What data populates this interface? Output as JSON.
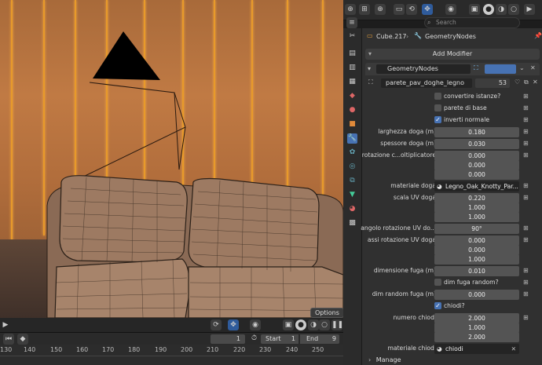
{
  "header": {
    "search_placeholder": "Search"
  },
  "object": {
    "name": "Cube.217",
    "modifier_name": "GeometryNodes"
  },
  "buttons": {
    "add_modifier": "Add Modifier",
    "options": "Options",
    "manage": "Manage"
  },
  "modifier": {
    "name": "GeometryNodes",
    "node_group": "parete_pav_doghe_legno",
    "users": "53"
  },
  "inputs": {
    "convertire_istanze": {
      "label": "convertire istanze?",
      "checked": false
    },
    "parete_di_base": {
      "label": "parete di base",
      "checked": false
    },
    "inverti_normale": {
      "label": "inverti normale",
      "checked": true
    },
    "larghezza_doga": {
      "label": "larghezza doga (m)",
      "value": "0.180"
    },
    "spessore_doga": {
      "label": "spessore doga (m)",
      "value": "0.030"
    },
    "rotazione": {
      "label": "rotazione c...oltiplicatore",
      "values": [
        "0.000",
        "0.000",
        "0.000"
      ]
    },
    "materiale_doga": {
      "label": "materiale doga",
      "value": "Legno_Oak_Knotty_Par..."
    },
    "scala_uv": {
      "label": "scala UV doga",
      "values": [
        "0.220",
        "1.000",
        "1.000"
      ]
    },
    "angolo_rotazione": {
      "label": "angolo rotazione UV do...",
      "value": "90°"
    },
    "assi_rotazione": {
      "label": "assi rotazione UV doga",
      "values": [
        "0.000",
        "0.000",
        "1.000"
      ]
    },
    "dimensione_fuga": {
      "label": "dimensione fuga (m)",
      "value": "0.010"
    },
    "dim_fuga_random_toggle": {
      "label": "dim fuga random?",
      "checked": false
    },
    "dim_random_fuga": {
      "label": "dim random fuga (m)",
      "value": "0.000"
    },
    "chiodi": {
      "label": "chiodi?",
      "checked": true
    },
    "numero_chiodi": {
      "label": "numero chiodi",
      "values": [
        "2.000",
        "1.000",
        "2.000"
      ]
    },
    "materiale_chiodi": {
      "label": "materiale chiodi",
      "value": "chiodi"
    }
  },
  "timeline": {
    "current_frame": "1",
    "start_label": "Start",
    "start_value": "1",
    "end_label": "End",
    "end_value": "9",
    "ticks": [
      "130",
      "140",
      "150",
      "160",
      "170",
      "180",
      "190",
      "200",
      "210",
      "220",
      "230",
      "240",
      "250"
    ]
  },
  "colors": {
    "accent": "#4772b3",
    "plank_glow": "#e89a2a",
    "panel_bg": "#303030"
  }
}
